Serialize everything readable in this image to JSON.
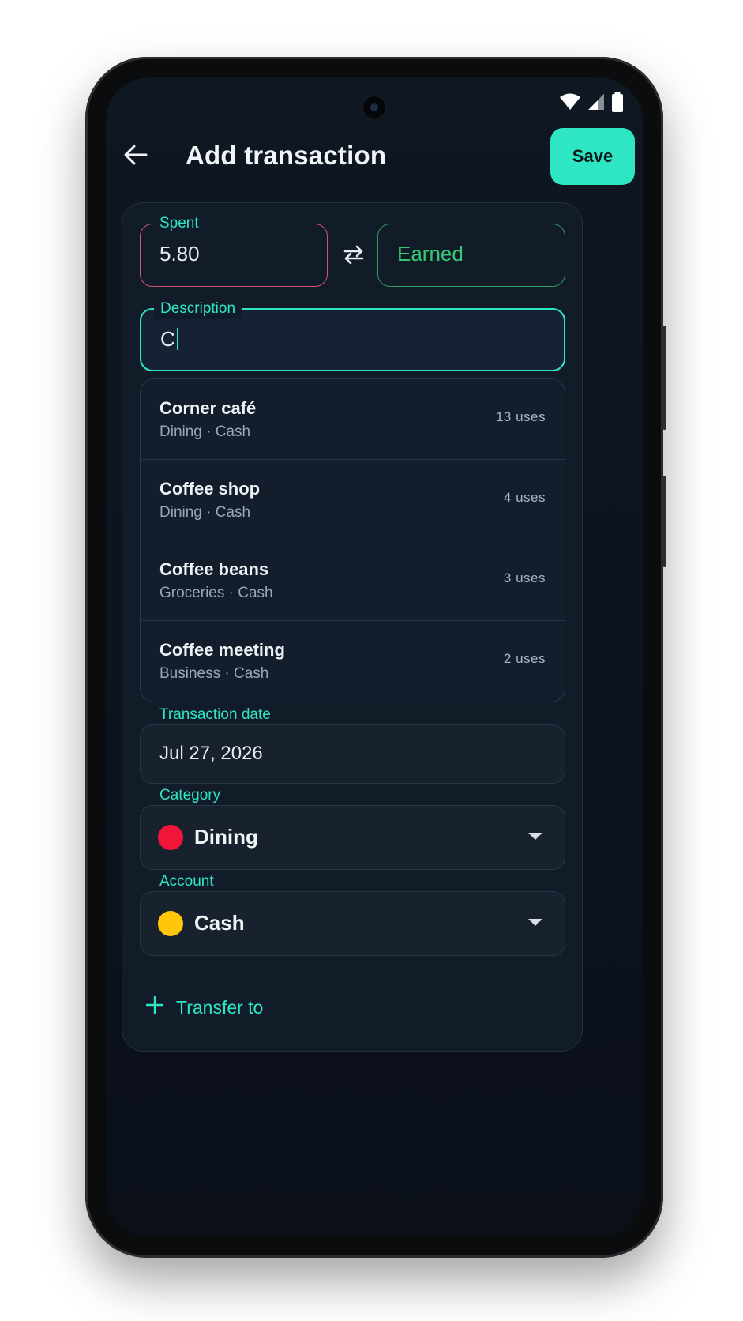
{
  "app": {
    "title": "Add transaction",
    "save_label": "Save"
  },
  "amount": {
    "spent_label": "Spent",
    "spent_value": "5.80",
    "earned_label": "Earned"
  },
  "description": {
    "label": "Description",
    "value": "C"
  },
  "suggestions": [
    {
      "name": "Corner café",
      "detail": "Dining · Cash",
      "uses": "13 uses"
    },
    {
      "name": "Coffee shop",
      "detail": "Dining · Cash",
      "uses": "4 uses"
    },
    {
      "name": "Coffee beans",
      "detail": "Groceries · Cash",
      "uses": "3 uses"
    },
    {
      "name": "Coffee meeting",
      "detail": "Business · Cash",
      "uses": "2 uses"
    }
  ],
  "date": {
    "label": "Transaction date",
    "value": "Jul 27, 2026"
  },
  "category": {
    "label": "Category",
    "value": "Dining",
    "color": "#f0163a"
  },
  "account": {
    "label": "Account",
    "value": "Cash",
    "color": "#ffc60a"
  },
  "transfer": {
    "label": "Transfer to"
  },
  "colors": {
    "accent": "#2ee6c4",
    "spent": "#d0566f",
    "earned": "#2fbf6a"
  },
  "icons": {
    "back": "arrow-left-icon",
    "swap": "swap-icon",
    "add": "plus-icon",
    "wifi": "wifi-icon",
    "signal": "signal-icon",
    "battery": "battery-icon"
  }
}
